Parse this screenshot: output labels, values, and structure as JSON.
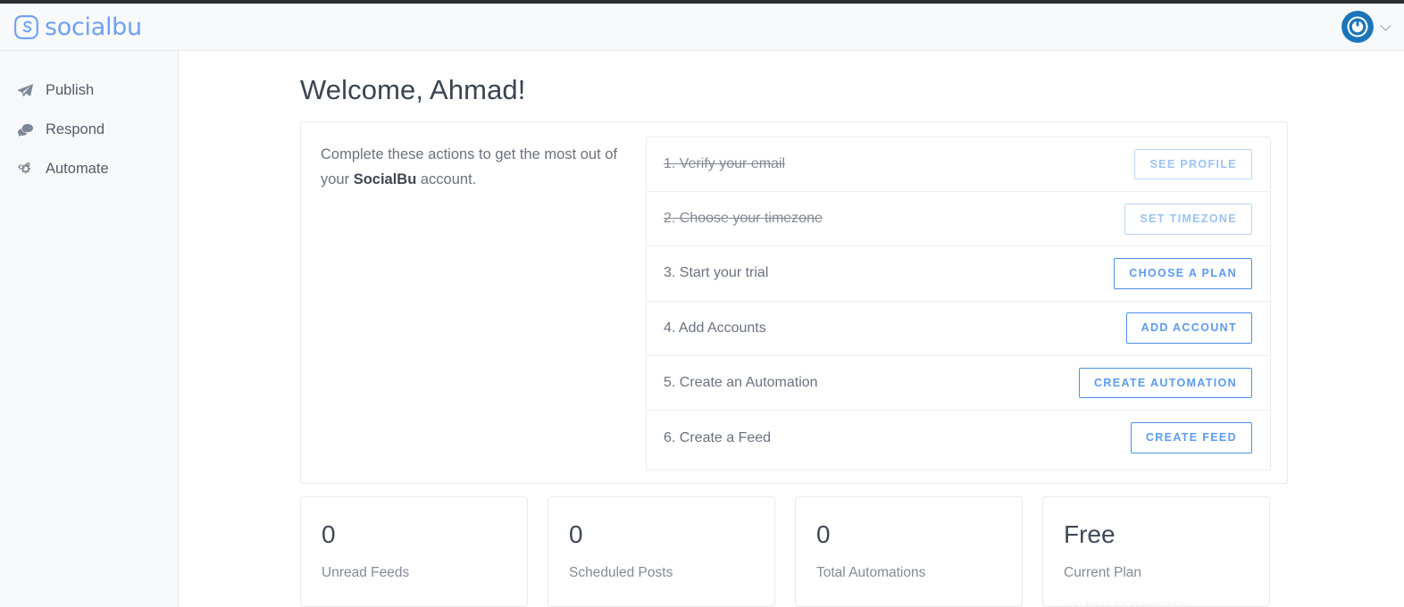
{
  "topbar": {
    "brand_name": "socialbu",
    "brand_mark_icon": "socialbu-logo-icon",
    "avatar_icon": "gravatar-avatar-icon",
    "chevron_icon": "chevron-down-icon"
  },
  "sidebar": {
    "items": [
      {
        "label": "Publish",
        "icon": "paper-plane-icon"
      },
      {
        "label": "Respond",
        "icon": "comment-icon"
      },
      {
        "label": "Automate",
        "icon": "gears-icon"
      }
    ]
  },
  "main": {
    "page_title": "Welcome, Ahmad!",
    "onboarding": {
      "blurb_prefix": "Complete these actions to get the most out of your ",
      "blurb_brand": "SocialBu",
      "blurb_suffix": " account.",
      "steps": [
        {
          "text": "1. Verify your email",
          "button": "SEE PROFILE",
          "done": true
        },
        {
          "text": "2. Choose your timezone",
          "button": "SET TIMEZONE",
          "done": true
        },
        {
          "text": "3. Start your trial",
          "button": "CHOOSE A PLAN",
          "done": false
        },
        {
          "text": "4. Add Accounts",
          "button": "ADD ACCOUNT",
          "done": false
        },
        {
          "text": "5. Create an Automation",
          "button": "CREATE AUTOMATION",
          "done": false
        },
        {
          "text": "6. Create a Feed",
          "button": "CREATE FEED",
          "done": false
        }
      ]
    },
    "stats": [
      {
        "value": "0",
        "label": "Unread Feeds",
        "note": ""
      },
      {
        "value": "0",
        "label": "Scheduled Posts",
        "note": ""
      },
      {
        "value": "0",
        "label": "Total Automations",
        "note": ""
      },
      {
        "value": "Free",
        "label": "Current Plan",
        "note": "you have no subscription"
      }
    ]
  },
  "colors": {
    "accent_blue": "#4a90e8",
    "accent_blue_muted": "#9cc3f2",
    "brand_blue": "#6fa0f5",
    "sidebar_bg": "#f7f8fa",
    "topbar_bg": "#f7f9fb",
    "border": "#e8eaed",
    "text_primary": "#3b4451",
    "text_muted": "#6b727e"
  }
}
